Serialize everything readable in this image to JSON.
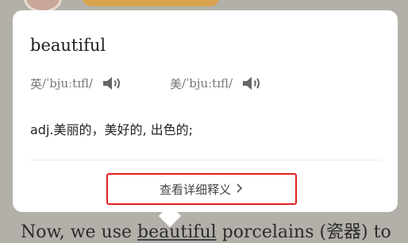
{
  "background_text": {
    "before": "Now, we use ",
    "highlight": "beautiful",
    "after": " porcelains (瓷器) to"
  },
  "popup": {
    "word": "beautiful",
    "phonetics": [
      {
        "region": "英",
        "ipa": "/ˈbjuːtɪfl/",
        "icon": "speaker-icon"
      },
      {
        "region": "美",
        "ipa": "/ˈbjuːtɪfl/",
        "icon": "speaker-icon"
      }
    ],
    "definition": "adj.美丽的，美好的, 出色的;",
    "detail_label": "查看详细释义",
    "detail_icon": "chevron-right-icon"
  },
  "colors": {
    "highlight_border": "#e02020",
    "backdrop": "#b3b0aa",
    "pill": "#d9a44d"
  }
}
